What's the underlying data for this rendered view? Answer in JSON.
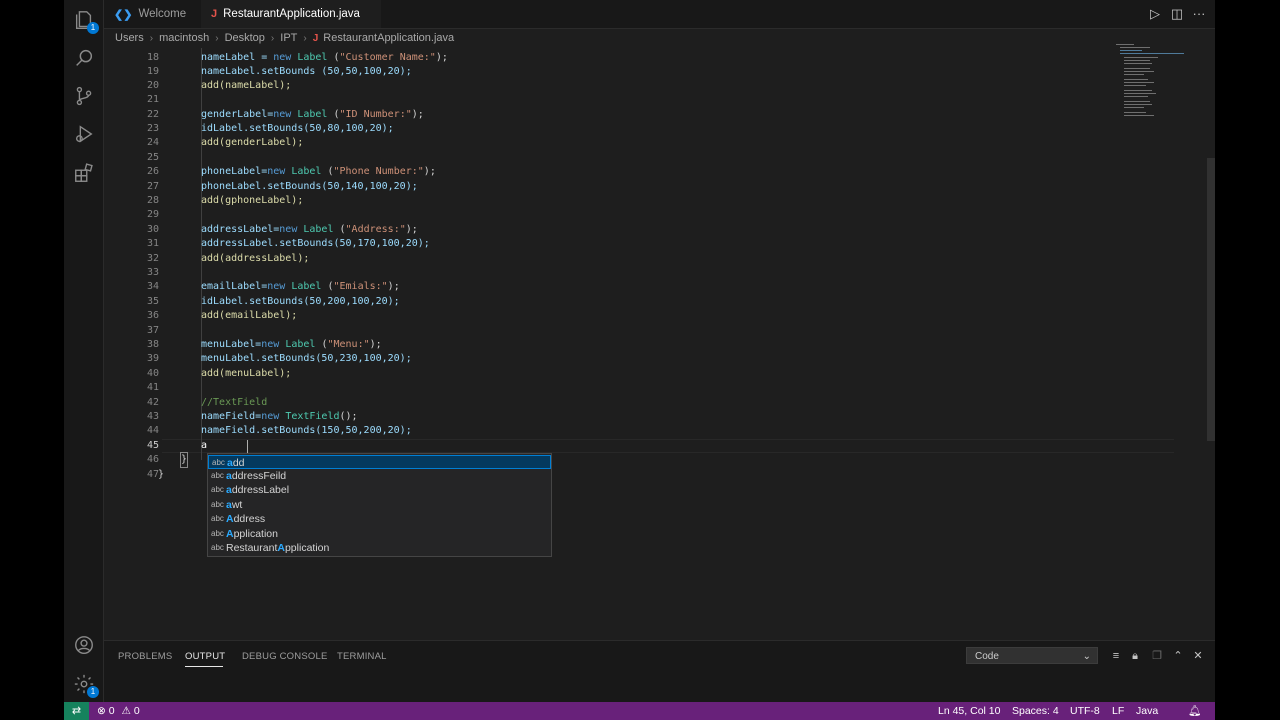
{
  "tabs": [
    {
      "label": "Welcome",
      "icon": "vscode-logo-icon",
      "active": false
    },
    {
      "label": "RestaurantApplication.java",
      "icon": "java-icon",
      "active": true,
      "dirty": true
    }
  ],
  "breadcrumbs": [
    "Users",
    "macintosh",
    "Desktop",
    "IPT",
    "RestaurantApplication.java"
  ],
  "activity_badges": {
    "explorer": "1",
    "settings": "1"
  },
  "editor": {
    "line_numbers": [
      "18",
      "19",
      "20",
      "21",
      "22",
      "23",
      "24",
      "25",
      "26",
      "27",
      "28",
      "29",
      "30",
      "31",
      "32",
      "33",
      "34",
      "35",
      "36",
      "37",
      "38",
      "39",
      "40",
      "41",
      "42",
      "43",
      "44",
      "45",
      "46",
      "47"
    ],
    "current_line": "45",
    "lines": {
      "l18": {
        "a": "nameLabel = ",
        "b": "new",
        "c": " ",
        "d": "Label",
        "e": " (",
        "f": "\"Customer Name:\"",
        "g": ");"
      },
      "l19": "nameLabel.setBounds (50,50,100,20);",
      "l20": "add(nameLabel);",
      "l22": {
        "a": "genderLabel=",
        "b": "new",
        "c": " ",
        "d": "Label",
        "e": " (",
        "f": "\"ID Number:\"",
        "g": ");"
      },
      "l23": "idLabel.setBounds(50,80,100,20);",
      "l24": "add(genderLabel);",
      "l26": {
        "a": "phoneLabel=",
        "b": "new",
        "c": " ",
        "d": "Label",
        "e": " (",
        "f": "\"Phone Number:\"",
        "g": ");"
      },
      "l27": "phoneLabel.setBounds(50,140,100,20);",
      "l28": "add(gphoneLabel);",
      "l30": {
        "a": "addressLabel=",
        "b": "new",
        "c": " ",
        "d": "Label",
        "e": " (",
        "f": "\"Address:\"",
        "g": ");"
      },
      "l31": "addressLabel.setBounds(50,170,100,20);",
      "l32": "add(addressLabel);",
      "l34": {
        "a": "emailLabel=",
        "b": "new",
        "c": " ",
        "d": "Label",
        "e": " (",
        "f": "\"Emials:\"",
        "g": ");"
      },
      "l35": "idLabel.setBounds(50,200,100,20);",
      "l36": "add(emailLabel);",
      "l38": {
        "a": "menuLabel=",
        "b": "new",
        "c": " ",
        "d": "Label",
        "e": " (",
        "f": "\"Menu:\"",
        "g": ");"
      },
      "l39": "menuLabel.setBounds(50,230,100,20);",
      "l40": "add(menuLabel);",
      "l42": "//TextField",
      "l43": {
        "a": "nameField=",
        "b": "new",
        "c": " ",
        "d": "TextField",
        "g": "();"
      },
      "l44": "nameField.setBounds(150,50,200,20);",
      "l45": "a",
      "l46": "}",
      "l47": "}"
    }
  },
  "suggestions": {
    "kind": "abc",
    "items": [
      {
        "hl": "a",
        "rest": "dd",
        "selected": true
      },
      {
        "hl": "a",
        "rest": "ddressFeild"
      },
      {
        "hl": "a",
        "rest": "ddressLabel"
      },
      {
        "hl": "a",
        "rest": "wt"
      },
      {
        "hl": "A",
        "rest": "ddress"
      },
      {
        "hl": "A",
        "rest": "pplication"
      },
      {
        "pre": "Restaurant",
        "hl": "A",
        "rest": "pplication"
      }
    ]
  },
  "panel": {
    "tabs": [
      "PROBLEMS",
      "OUTPUT",
      "DEBUG CONSOLE",
      "TERMINAL"
    ],
    "active_tab": "OUTPUT",
    "output_channel": "Code"
  },
  "status": {
    "errors": "0",
    "warnings": "0",
    "position": "Ln 45, Col 10",
    "spaces": "Spaces: 4",
    "encoding": "UTF-8",
    "eol": "LF",
    "language": "Java"
  },
  "colors": {
    "status_bar": "#68217a",
    "remote": "#16825d",
    "accent": "#0078d4"
  }
}
